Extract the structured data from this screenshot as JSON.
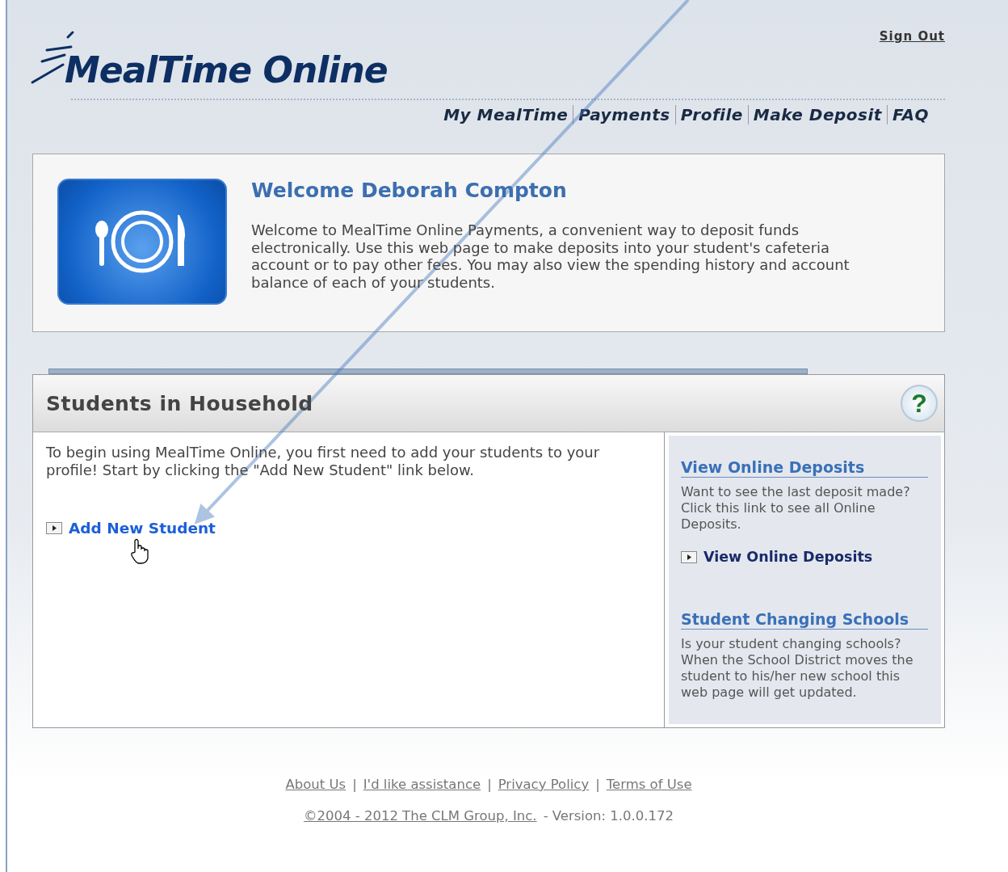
{
  "annotation": {
    "kind": "arrow"
  },
  "header": {
    "logo": "MealTime Online",
    "sign_out": "Sign Out",
    "nav": [
      "My MealTime",
      "Payments",
      "Profile",
      "Make Deposit",
      "FAQ"
    ]
  },
  "welcome": {
    "title": "Welcome Deborah Compton",
    "text": "Welcome to MealTime Online Payments, a convenient way to deposit funds electronically. Use this web page to make deposits into your student's cafeteria account or to pay other fees. You may also view the spending history and account balance of each of your students."
  },
  "students_panel": {
    "title": "Students in Household",
    "help": "?",
    "intro": "To begin using MealTime Online, you first need to add your students to your profile! Start by clicking the \"Add New Student\" link below.",
    "add_link": "Add New Student",
    "sidebar": [
      {
        "heading": "View Online Deposits",
        "text": "Want to see the last deposit made? Click this link to see all Online Deposits.",
        "link": "View Online Deposits"
      },
      {
        "heading": "Student Changing Schools",
        "text": "Is your student changing schools? When the School District moves the student to his/her new school this web page will get updated."
      }
    ]
  },
  "footer": {
    "links": [
      "About Us",
      "I'd like assistance",
      "Privacy Policy",
      "Terms of Use"
    ],
    "separators": [
      "|",
      "|",
      "|"
    ],
    "copyright_link": "©2004 - 2012 The CLM Group, Inc.",
    "version": "- Version: 1.0.0.172"
  }
}
